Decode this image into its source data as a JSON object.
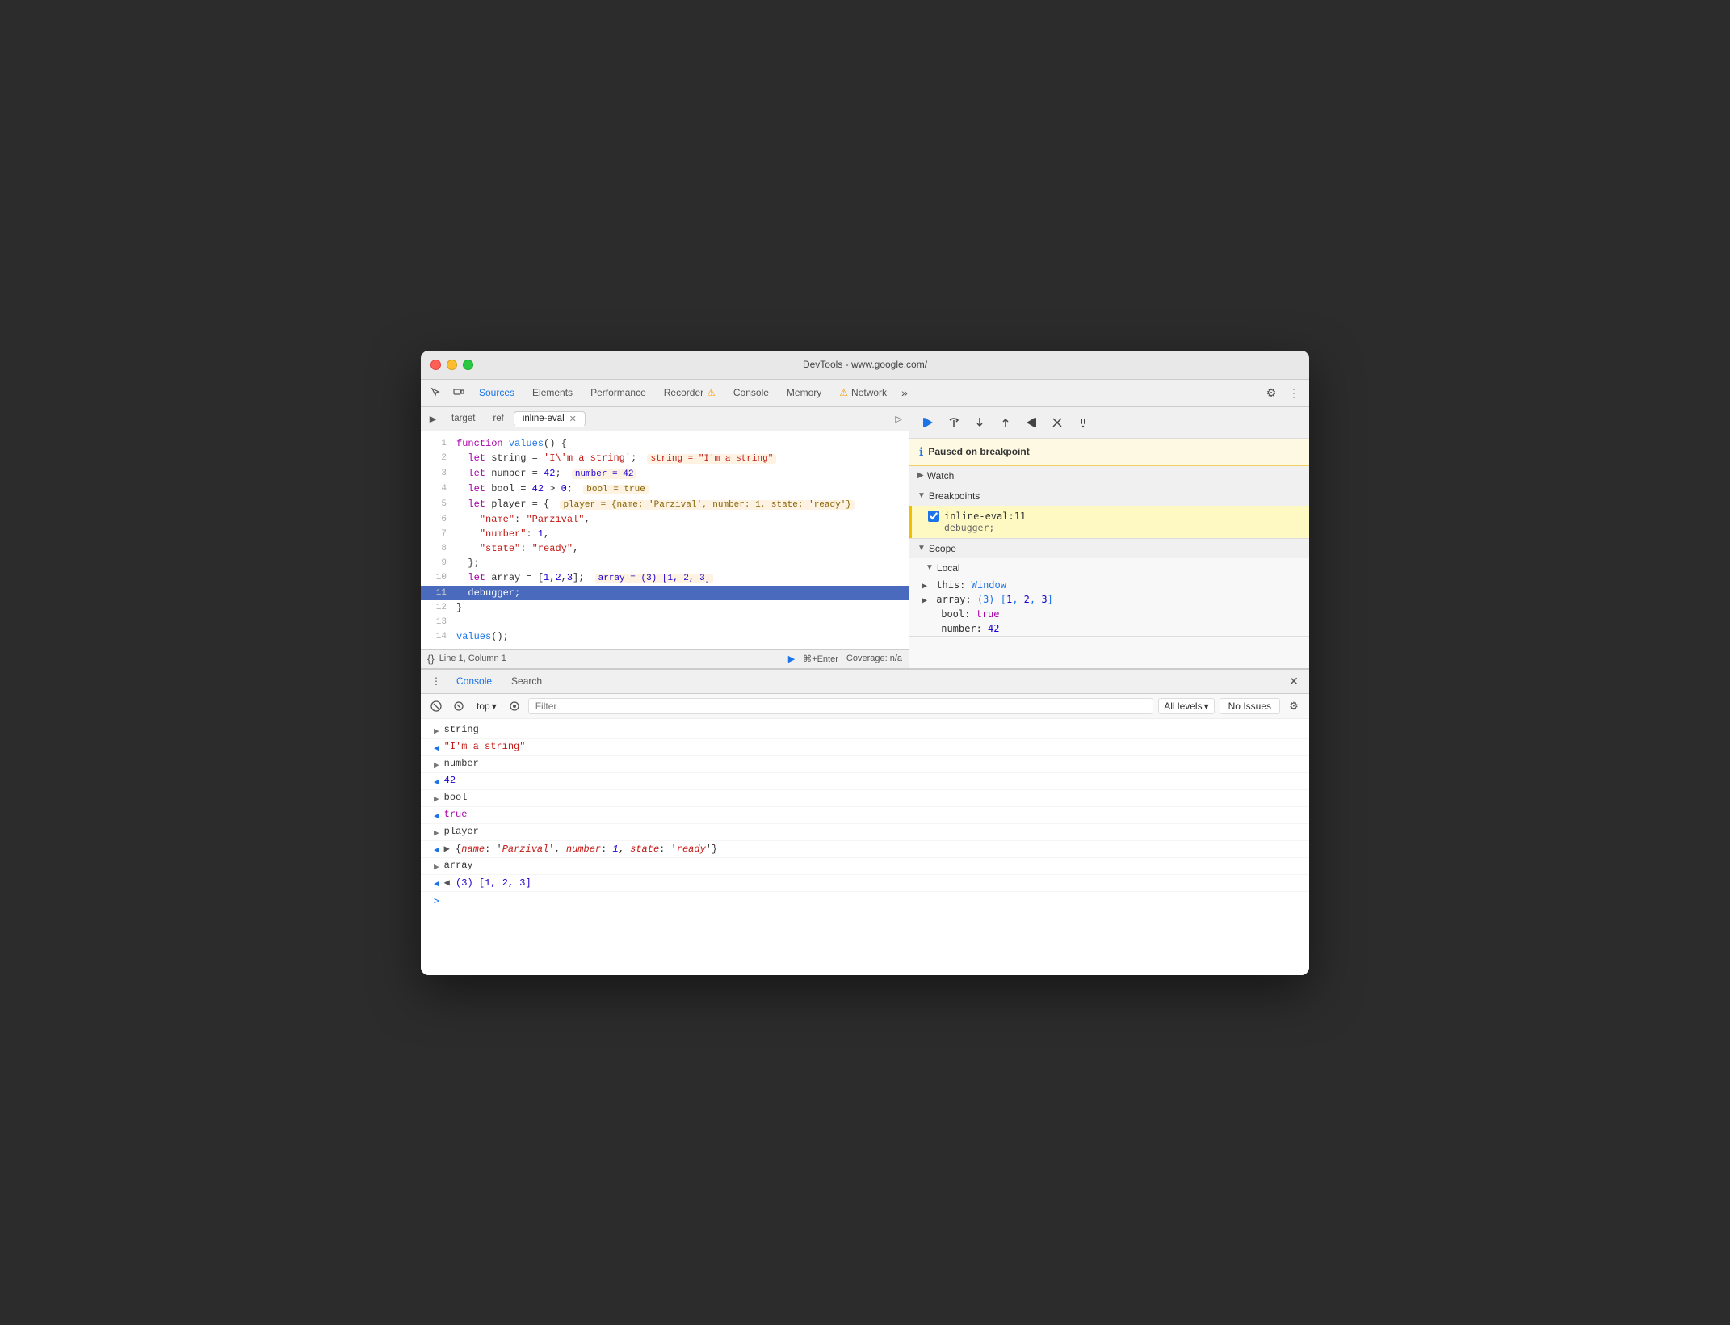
{
  "window": {
    "title": "DevTools - www.google.com/",
    "traffic_lights": [
      "red",
      "yellow",
      "green"
    ]
  },
  "nav": {
    "tabs": [
      {
        "label": "Sources",
        "active": true
      },
      {
        "label": "Elements",
        "active": false
      },
      {
        "label": "Performance",
        "active": false
      },
      {
        "label": "Recorder",
        "active": false
      },
      {
        "label": "Console",
        "active": false
      },
      {
        "label": "Memory",
        "active": false
      },
      {
        "label": "Network",
        "active": false
      }
    ],
    "more_label": "»",
    "settings_icon": "gear-icon",
    "more_dots_icon": "more-dots-icon"
  },
  "file_tabs": {
    "items": [
      {
        "label": "target",
        "active": false,
        "closable": false
      },
      {
        "label": "ref",
        "active": false,
        "closable": false
      },
      {
        "label": "inline-eval",
        "active": true,
        "closable": true
      }
    ]
  },
  "code": {
    "lines": [
      {
        "num": 1,
        "content": "function values() {"
      },
      {
        "num": 2,
        "content": "  let string = 'I\\'m a string';",
        "inline": "string = \"I'm a string\""
      },
      {
        "num": 3,
        "content": "  let number = 42;",
        "inline": "number = 42"
      },
      {
        "num": 4,
        "content": "  let bool = 42 > 0;",
        "inline": "bool = true"
      },
      {
        "num": 5,
        "content": "  let player = {",
        "inline": "player = {name: 'Parzival', number: 1, state: 'ready'}"
      },
      {
        "num": 6,
        "content": "    \"name\": \"Parzival\","
      },
      {
        "num": 7,
        "content": "    \"number\": 1,"
      },
      {
        "num": 8,
        "content": "    \"state\": \"ready\","
      },
      {
        "num": 9,
        "content": "  };"
      },
      {
        "num": 10,
        "content": "  let array = [1,2,3];",
        "inline": "array = (3) [1, 2, 3]"
      },
      {
        "num": 11,
        "content": "  debugger;",
        "highlighted": true
      },
      {
        "num": 12,
        "content": "}"
      },
      {
        "num": 13,
        "content": ""
      },
      {
        "num": 14,
        "content": "values();"
      }
    ]
  },
  "status_bar": {
    "cursor": "Line 1, Column 1",
    "run_label": "⌘+Enter",
    "coverage": "Coverage: n/a"
  },
  "debugger": {
    "paused_text": "Paused on breakpoint",
    "toolbar_buttons": [
      "resume",
      "step-over",
      "step-into",
      "step-out",
      "step-back",
      "deactivate",
      "pause-exceptions"
    ],
    "watch_label": "Watch",
    "breakpoints_label": "Breakpoints",
    "breakpoint_file": "inline-eval:11",
    "breakpoint_stmt": "debugger;",
    "scope_label": "Scope",
    "local_label": "Local",
    "scope_items": [
      {
        "key": "this:",
        "val": "Window",
        "expandable": true
      },
      {
        "key": "array:",
        "val": "(3) [1, 2, 3]",
        "expandable": true
      },
      {
        "key": "bool:",
        "val": "true",
        "expandable": false
      },
      {
        "key": "number:",
        "val": "42",
        "expandable": false
      }
    ]
  },
  "bottom_panel": {
    "tabs": [
      {
        "label": "Console",
        "active": true
      },
      {
        "label": "Search",
        "active": false
      }
    ],
    "toolbar": {
      "top_label": "top",
      "filter_placeholder": "Filter",
      "levels_label": "All levels",
      "issues_label": "No Issues"
    },
    "console_entries": [
      {
        "type": "out",
        "text": "string"
      },
      {
        "type": "in",
        "text": "\"I'm a string\"",
        "color": "str"
      },
      {
        "type": "out",
        "text": "number"
      },
      {
        "type": "in",
        "text": "42",
        "color": "num"
      },
      {
        "type": "out",
        "text": "bool"
      },
      {
        "type": "in",
        "text": "true",
        "color": "bool"
      },
      {
        "type": "out",
        "text": "player"
      },
      {
        "type": "in",
        "text": "▶ {name: 'Parzival', number: 1, state: 'ready'}",
        "color": "obj"
      },
      {
        "type": "out",
        "text": "array"
      },
      {
        "type": "in",
        "text": "◀ (3) [1, 2, 3]",
        "color": "num"
      }
    ],
    "prompt": ">"
  }
}
